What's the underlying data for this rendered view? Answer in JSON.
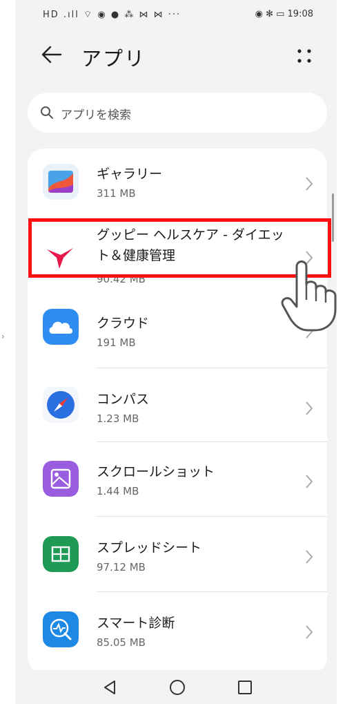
{
  "status_bar": {
    "left_icons": "HD .ıll ⌔ ◉ ● ⁂ ⋈ ⋈ ···",
    "right_icons": "◉ ✻ ▭",
    "time": "19:08"
  },
  "header": {
    "title": "アプリ"
  },
  "search": {
    "placeholder": "アプリを検索"
  },
  "apps": [
    {
      "name": "ギャラリー",
      "size": "311 MB",
      "icon": "gallery-icon"
    },
    {
      "name": "グッピー ヘルスケア - ダイエット＆健康管理",
      "size": "90.42 MB",
      "icon": "guppy-heart-icon"
    },
    {
      "name": "クラウド",
      "size": "191 MB",
      "icon": "cloud-icon"
    },
    {
      "name": "コンパス",
      "size": "1.23 MB",
      "icon": "compass-icon"
    },
    {
      "name": "スクロールショット",
      "size": "1.44 MB",
      "icon": "scrollshot-icon"
    },
    {
      "name": "スプレッドシート",
      "size": "97.12 MB",
      "icon": "spreadsheet-icon"
    },
    {
      "name": "スマート診断",
      "size": "85.05 MB",
      "icon": "smart-diagnosis-icon"
    }
  ],
  "colors": {
    "highlight": "#ff1010",
    "background": "#f1f3f5"
  }
}
